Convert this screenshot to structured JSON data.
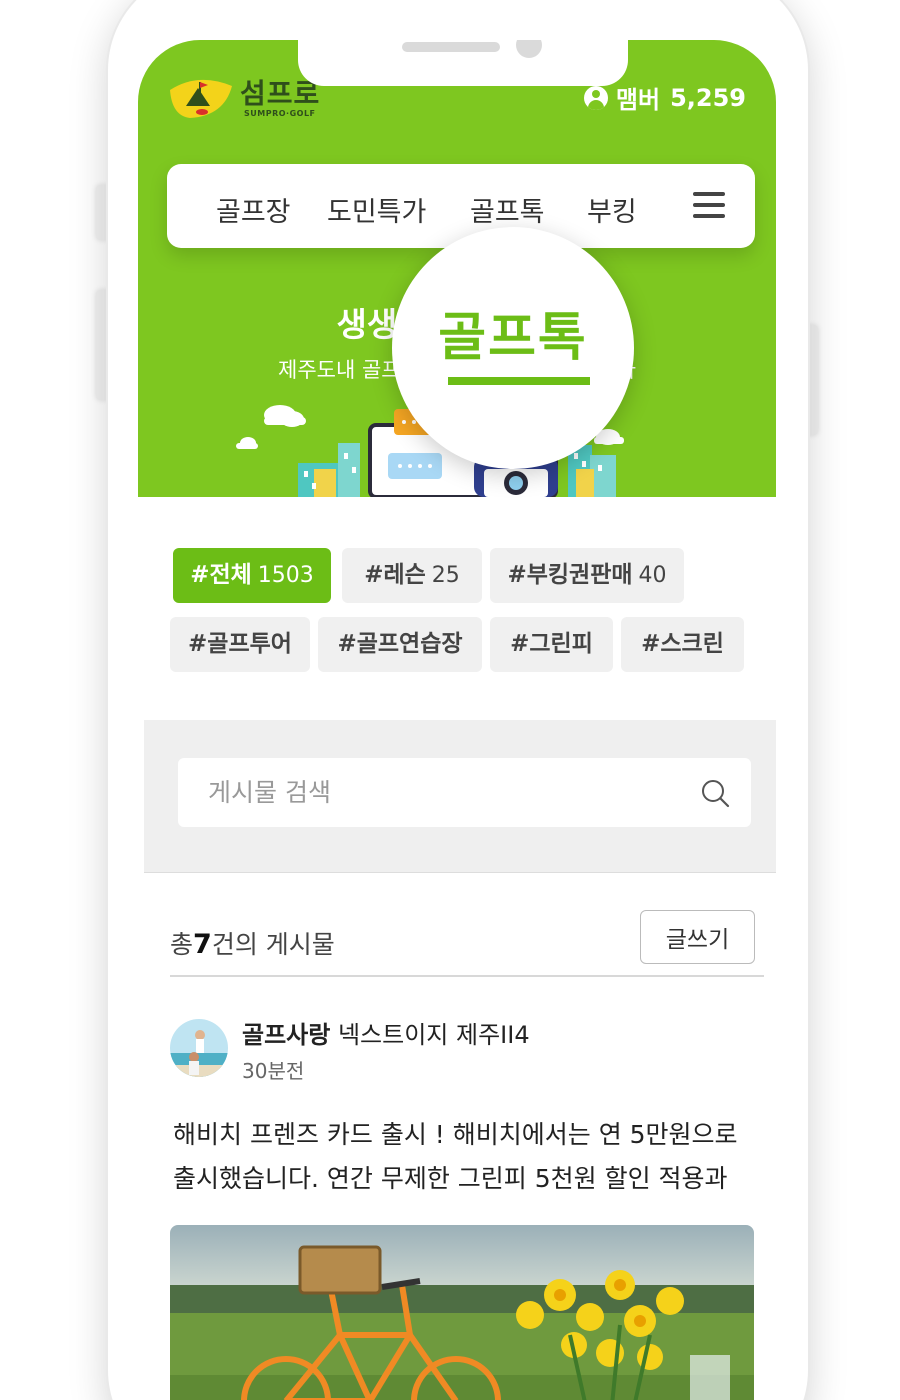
{
  "brand": {
    "logo_text": "섬프로",
    "logo_sub": "SUMPRO·GOLF"
  },
  "member": {
    "label": "맴버",
    "count": "5,259"
  },
  "nav": {
    "items": [
      {
        "label": "골프장"
      },
      {
        "label": "도민특가"
      },
      {
        "label": "골프톡"
      },
      {
        "label": "부킹"
      }
    ],
    "menu_icon": "hamburger-menu-icon"
  },
  "hero": {
    "title": "생생한",
    "subtitle": "제주도내 골프",
    "subtitle_end": "다",
    "magnified_label": "골프톡"
  },
  "tags": [
    {
      "label": "#전체",
      "count": "1503",
      "active": true
    },
    {
      "label": "#레슨",
      "count": "25",
      "active": false
    },
    {
      "label": "#부킹권판매",
      "count": "40",
      "active": false
    },
    {
      "label": "#골프투어",
      "count": "",
      "active": false
    },
    {
      "label": "#골프연습장",
      "count": "",
      "active": false
    },
    {
      "label": "#그린피",
      "count": "",
      "active": false
    },
    {
      "label": "#스크린",
      "count": "",
      "active": false
    }
  ],
  "search": {
    "placeholder": "게시물 검색",
    "icon": "search-icon"
  },
  "list": {
    "total_prefix": "총",
    "total_count": "7",
    "total_suffix": "건의 게시물",
    "write_label": "글쓰기"
  },
  "post": {
    "author": "골프사랑",
    "course": "넥스트이지 제주II4",
    "time": "30분전",
    "body_line1": "해비치 프렌즈 카드 출시 ! 해비치에서는 연 5만원으로",
    "body_line2": "출시했습니다. 연간 무제한 그린피 5천원 할인 적용과"
  },
  "colors": {
    "brand_green": "#7ec720",
    "accent_green": "#6cbd16"
  }
}
